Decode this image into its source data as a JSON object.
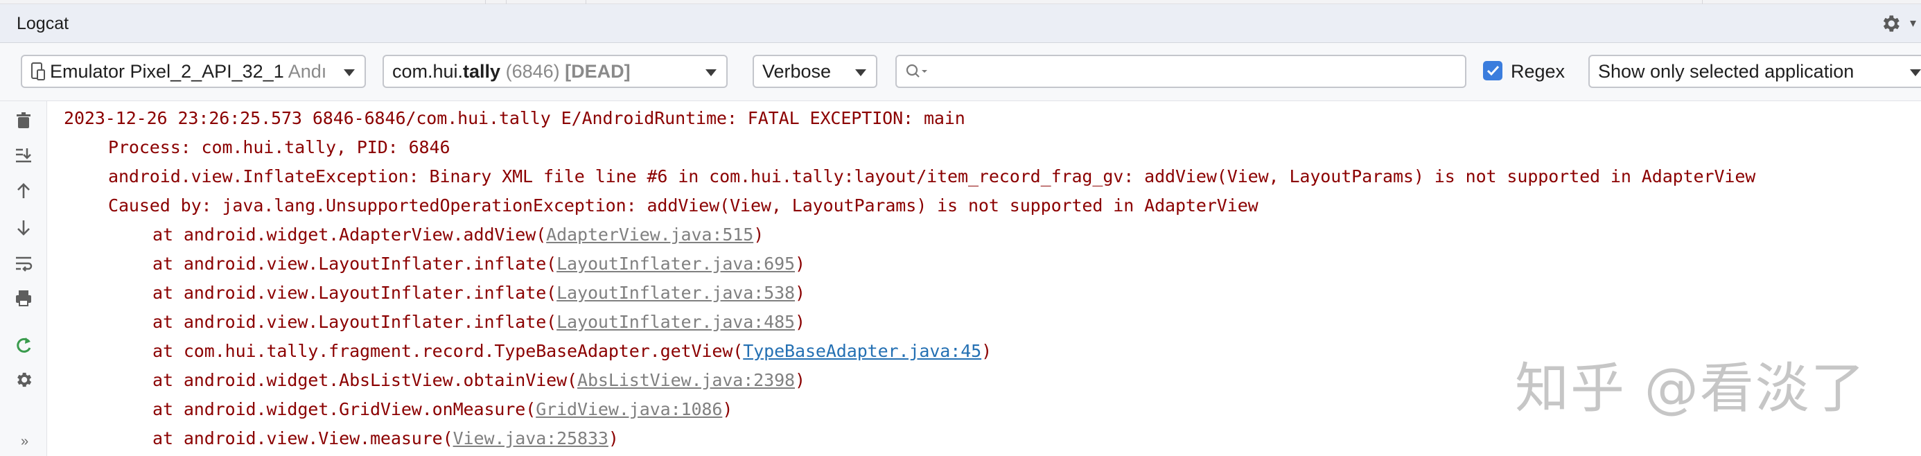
{
  "window": {
    "title": "Logcat"
  },
  "toolbar": {
    "device": {
      "label": "Emulator Pixel_2_API_32_1",
      "suffix": "Andı"
    },
    "process": {
      "prefix": "com.hui.",
      "bold": "tally",
      "pid": " (6846) ",
      "state": "[DEAD]"
    },
    "level": {
      "label": "Verbose"
    },
    "search": {
      "value": "",
      "placeholder": ""
    },
    "regex": {
      "label": "Regex",
      "checked": true
    },
    "scope": {
      "label": "Show only selected application"
    }
  },
  "sidebar": {
    "icons": [
      "trash-icon",
      "scroll-to-end-icon",
      "up-arrow-icon",
      "down-arrow-icon",
      "soft-wrap-icon",
      "print-icon",
      "restart-icon",
      "settings-icon"
    ],
    "more": "»"
  },
  "log": {
    "lines": [
      {
        "text": "2023-12-26 23:26:25.573 6846-6846/com.hui.tally E/AndroidRuntime: FATAL EXCEPTION: main"
      },
      {
        "text": "Process: com.hui.tally, PID: 6846"
      },
      {
        "text": "android.view.InflateException: Binary XML file line #6 in com.hui.tally:layout/item_record_frag_gv: addView(View, LayoutParams) is not supported in AdapterView"
      },
      {
        "text": "Caused by: java.lang.UnsupportedOperationException: addView(View, LayoutParams) is not supported in AdapterView"
      },
      {
        "before": "at android.widget.AdapterView.addView(",
        "link": "AdapterView.java:515",
        "after": ")"
      },
      {
        "before": "at android.view.LayoutInflater.inflate(",
        "link": "LayoutInflater.java:695",
        "after": ")"
      },
      {
        "before": "at android.view.LayoutInflater.inflate(",
        "link": "LayoutInflater.java:538",
        "after": ")"
      },
      {
        "before": "at android.view.LayoutInflater.inflate(",
        "link": "LayoutInflater.java:485",
        "after": ")"
      },
      {
        "before": "at com.hui.tally.fragment.record.TypeBaseAdapter.getView(",
        "link": "TypeBaseAdapter.java:45",
        "after": ")"
      },
      {
        "before": "at android.widget.AbsListView.obtainView(",
        "link": "AbsListView.java:2398",
        "after": ")"
      },
      {
        "before": "at android.widget.GridView.onMeasure(",
        "link": "GridView.java:1086",
        "after": ")"
      },
      {
        "before": "at android.view.View.measure(",
        "link": "View.java:25833",
        "after": ")"
      }
    ]
  },
  "watermark": {
    "text": "知乎 @看淡了"
  },
  "colors": {
    "error_text": "#8b0000",
    "link_gray": "#808080",
    "link_blue": "#2470b3",
    "accent": "#3b7ddd"
  }
}
